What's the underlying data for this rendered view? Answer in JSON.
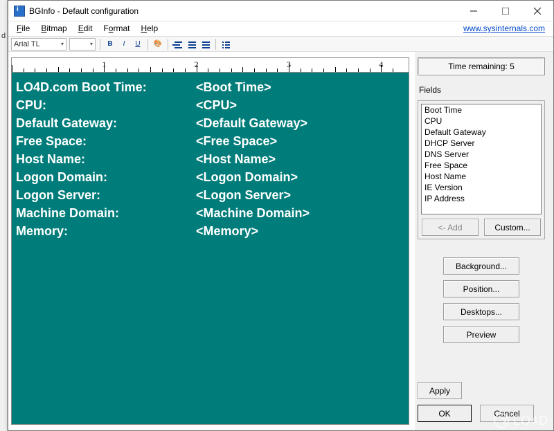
{
  "window": {
    "title": "BGInfo - Default configuration",
    "link": "www.sysinternals.com"
  },
  "menu": {
    "file": "File",
    "bitmap": "Bitmap",
    "edit": "Edit",
    "format": "Format",
    "help": "Help"
  },
  "toolbar": {
    "font_name": "Arial TL"
  },
  "time_remaining": "Time remaining: 5",
  "fields_label": "Fields",
  "fields": [
    "Boot Time",
    "CPU",
    "Default Gateway",
    "DHCP Server",
    "DNS Server",
    "Free Space",
    "Host Name",
    "IE Version",
    "IP Address"
  ],
  "buttons": {
    "add": "<- Add",
    "custom": "Custom...",
    "background": "Background...",
    "position": "Position...",
    "desktops": "Desktops...",
    "preview": "Preview",
    "apply": "Apply",
    "ok": "OK",
    "cancel": "Cancel"
  },
  "editor_rows": [
    {
      "label": "LO4D.com Boot Time:",
      "value": "<Boot Time>"
    },
    {
      "label": "CPU:",
      "value": "<CPU>"
    },
    {
      "label": "Default Gateway:",
      "value": "<Default Gateway>"
    },
    {
      "label": "Free Space:",
      "value": "<Free Space>"
    },
    {
      "label": "Host Name:",
      "value": "<Host Name>"
    },
    {
      "label": "Logon Domain:",
      "value": "<Logon Domain>"
    },
    {
      "label": "Logon Server:",
      "value": "<Logon Server>"
    },
    {
      "label": "Machine Domain:",
      "value": "<Machine Domain>"
    },
    {
      "label": "Memory:",
      "value": "<Memory>"
    }
  ],
  "watermark": "LO4D"
}
